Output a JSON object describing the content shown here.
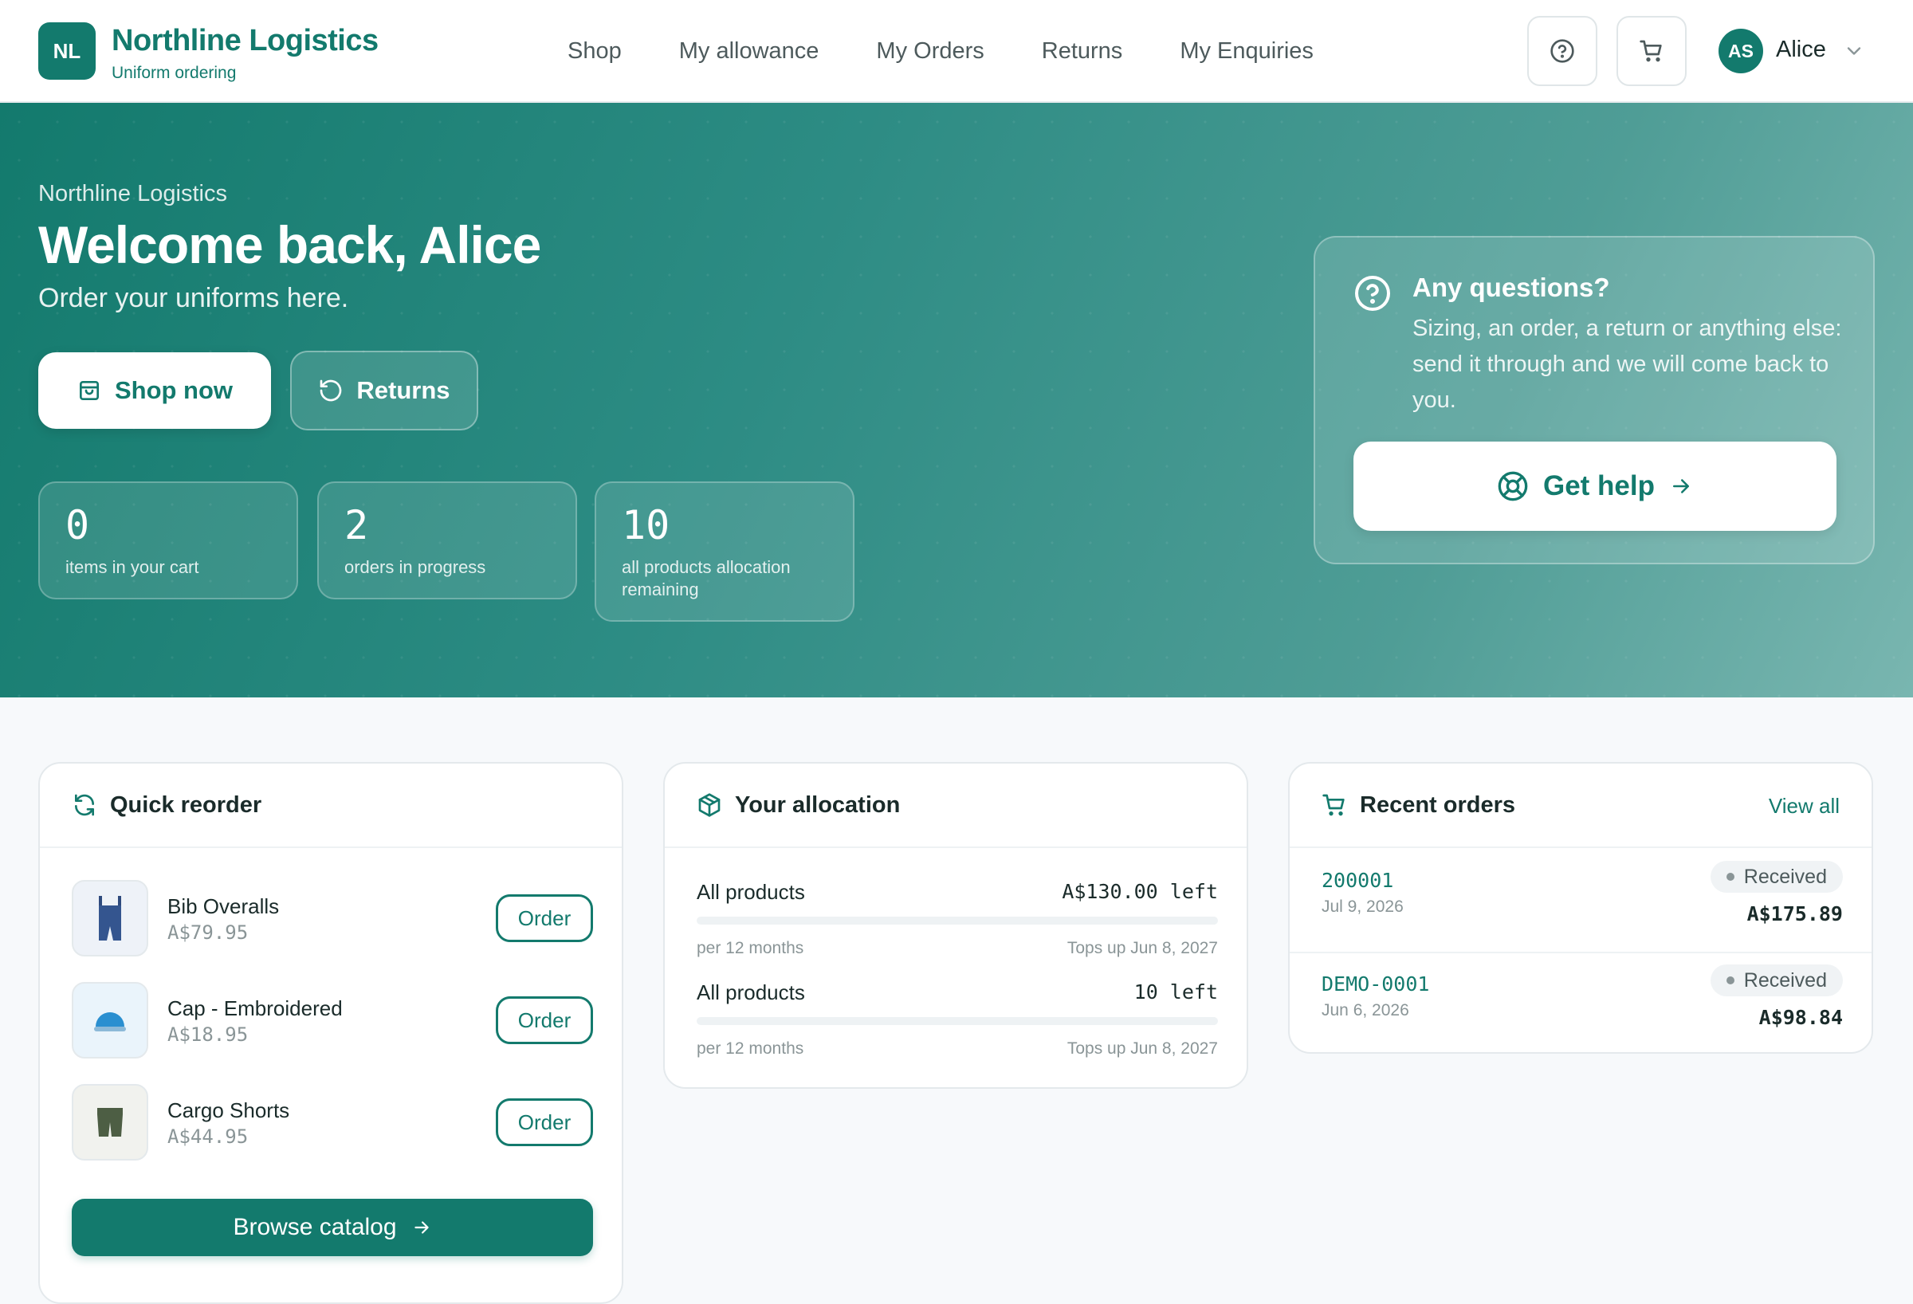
{
  "header": {
    "logo_initials": "NL",
    "brand_name": "Northline Logistics",
    "brand_sub": "Uniform ordering",
    "nav": [
      "Shop",
      "My allowance",
      "My Orders",
      "Returns",
      "My Enquiries"
    ],
    "user_initials": "AS",
    "user_name": "Alice"
  },
  "hero": {
    "company": "Northline Logistics",
    "title": "Welcome back, Alice",
    "subtitle": "Order your uniforms here.",
    "shop_label": "Shop now",
    "returns_label": "Returns",
    "stats": [
      {
        "value": "0",
        "label": "items in your cart"
      },
      {
        "value": "2",
        "label": "orders in progress"
      },
      {
        "value": "10",
        "label": "all products allocation remaining"
      }
    ],
    "questions": {
      "title": "Any questions?",
      "text": "Sizing, an order, a return or anything else: send it through and we will come back to you.",
      "button": "Get help"
    }
  },
  "quick_reorder": {
    "title": "Quick reorder",
    "items": [
      {
        "name": "Bib Overalls",
        "price": "A$79.95",
        "button": "Order"
      },
      {
        "name": "Cap - Embroidered",
        "price": "A$18.95",
        "button": "Order"
      },
      {
        "name": "Cargo Shorts",
        "price": "A$44.95",
        "button": "Order"
      }
    ],
    "browse_label": "Browse catalog"
  },
  "allocation": {
    "title": "Your allocation",
    "rows": [
      {
        "name": "All products",
        "left": "A$130.00 left",
        "period": "per 12 months",
        "topup": "Tops up Jun 8, 2027",
        "used_fraction": 0
      },
      {
        "name": "All products",
        "left": "10 left",
        "period": "per 12 months",
        "topup": "Tops up Jun 8, 2027",
        "used_fraction": 0
      }
    ]
  },
  "recent_orders": {
    "title": "Recent orders",
    "view_all": "View all",
    "orders": [
      {
        "id": "200001",
        "date": "Jul 9, 2026",
        "status": "Received",
        "total": "A$175.89"
      },
      {
        "id": "DEMO-0001",
        "date": "Jun 6, 2026",
        "status": "Received",
        "total": "A$98.84"
      }
    ]
  },
  "colors": {
    "brand": "#137a6d",
    "muted_text": "#8a9597"
  }
}
